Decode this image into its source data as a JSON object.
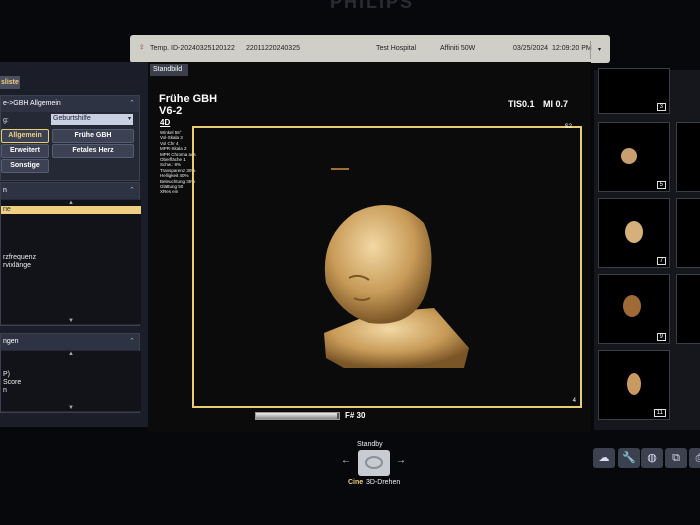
{
  "brand": "PHILIPS",
  "header": {
    "patient_icon": "patient-icon",
    "temp_id": "Temp. ID-20240325120122",
    "exam_id": "22011220240325",
    "hospital": "Test Hospital",
    "system": "Affiniti 50W",
    "date": "03/25/2024",
    "time": "12:09:20 PM"
  },
  "left": {
    "tab": "sliste",
    "protocol_title": "e->GBH Allgemein",
    "field_label": "g:",
    "field_value": "Geburtshilfe",
    "buttons": [
      "Allgemein",
      "Frühe GBH",
      "Erweitert",
      "Fetales Herz",
      "Sonstige"
    ],
    "section2_title": "n",
    "list2": [
      "rie",
      "",
      "",
      " ",
      " ",
      "",
      "rzfrequenz",
      "rvixlänge"
    ],
    "section3_title": "ngen",
    "list3": [
      "",
      "P)",
      "Score",
      "n"
    ]
  },
  "main": {
    "tab": "Standbild",
    "preset": "Frühe GBH",
    "probe": "V6-2",
    "mode": "4D",
    "tis": "TIS0.1",
    "mi": "MI 0.7",
    "gain_label": "S2",
    "params": [
      "Winkel 55°",
      "Vol-Skala 3",
      "Vol Chr 4",
      "MPR-Skala 2",
      "MPR Chroma aus",
      "Oberfläche 1",
      "Schw.: 8%",
      "Transparenz 30%",
      "Helligkeit 40%",
      "Beleuchtung 35%",
      "Glättung 50",
      "XRes ein"
    ],
    "corner_num": "4",
    "frame_label": "F# 30",
    "cine_progress": 0.98
  },
  "thumbnails": [
    "3",
    "5",
    "7",
    "9",
    "11"
  ],
  "bottom": {
    "standby": "Standby",
    "cine": "Cine",
    "rotate": "3D-Drehen"
  },
  "toolbar": [
    "cloud-icon",
    "wrench-icon",
    "globe-icon",
    "windows-icon",
    "printer-icon"
  ]
}
